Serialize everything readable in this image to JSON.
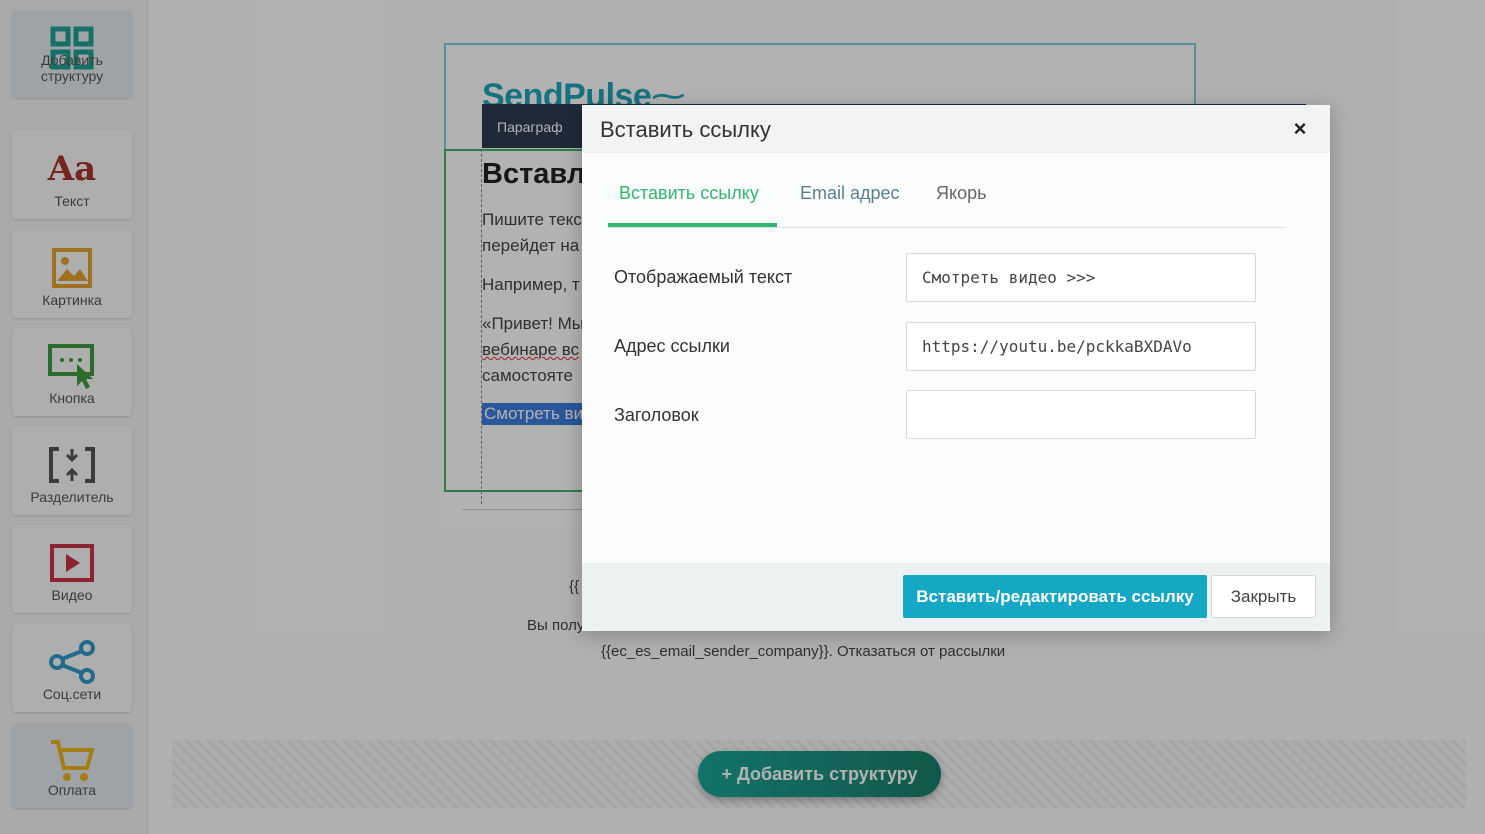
{
  "sidebar": {
    "items": [
      {
        "label": "Добавить структуру",
        "icon": "grid-layout-icon",
        "color": "#1fa294"
      },
      {
        "label": "Текст",
        "icon": "text-aa-icon",
        "color": "#a8352d"
      },
      {
        "label": "Картинка",
        "icon": "image-icon",
        "color": "#e3a32c"
      },
      {
        "label": "Кнопка",
        "icon": "button-cursor-icon",
        "color": "#3f9a3f"
      },
      {
        "label": "Разделитель",
        "icon": "divider-icon",
        "color": "#555555"
      },
      {
        "label": "Видео",
        "icon": "video-play-icon",
        "color": "#c9334a"
      },
      {
        "label": "Соц.сети",
        "icon": "share-icon",
        "color": "#2f9ac7"
      },
      {
        "label": "Оплата",
        "icon": "cart-icon",
        "color": "#e9b51c"
      }
    ]
  },
  "email": {
    "logo": "SendPulse",
    "toolbar_label": "Параграф",
    "heading": "Вставл",
    "text_lines": [
      "Пишите текс",
      "перейдет на",
      "Например, т",
      "«Привет! Мы",
      "вебинаре вс",
      "самостояте"
    ],
    "link_text": "Смотреть ви",
    "footer_var": "{{",
    "footer_line1": "Вы полу",
    "footer_line2": "{{ec_es_email_sender_company}}. Отказаться от рассылки"
  },
  "add_structure_button": "+ Добавить структуру",
  "modal": {
    "title": "Вставить ссылку",
    "close_glyph": "×",
    "tabs": [
      "Вставить ссылку",
      "Email адрес",
      "Якорь"
    ],
    "active_tab": 0,
    "fields": {
      "display_text_label": "Отображаемый текст",
      "display_text_value": "Смотреть видео >>>",
      "url_label": "Адрес ссылки",
      "url_value": "https://youtu.be/pckkaBXDAVo",
      "title_label": "Заголовок",
      "title_value": ""
    },
    "primary_button": "Вставить/редактировать ссылку",
    "close_button": "Закрыть"
  },
  "colors": {
    "accent_green": "#33b573",
    "primary_blue": "#14a8c4",
    "toolbar_dark": "#2c3e50"
  }
}
